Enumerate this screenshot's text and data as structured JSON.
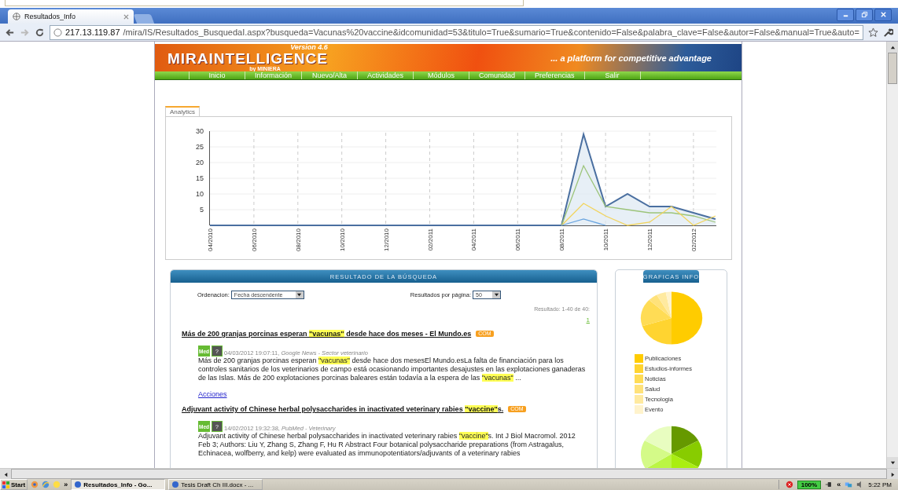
{
  "browser": {
    "tab_title": "Resultados_Info",
    "url_host": "217.13.119.87",
    "url_path": "/mira/IS/Resultados_BusquedaI.aspx?busqueda=Vacunas%20vaccine&idcomunidad=53&titulo=True&sumario=True&contenido=False&palabra_clave=False&autor=False&manual=True&auto="
  },
  "banner": {
    "logo": "MIRAINTELLIGENCE",
    "version": "Version 4.6",
    "by": "by MINIERA",
    "slogan": "... a platform for competitive advantage"
  },
  "nav": [
    "Inicio",
    "Información",
    "Nuevo/Alta",
    "Actividades",
    "Módulos",
    "Comunidad",
    "Preferencias",
    "Salir"
  ],
  "analytics": {
    "tab": "Analytics",
    "chart_data": {
      "type": "line",
      "categories": [
        "04/2010",
        null,
        "06/2010",
        null,
        "08/2010",
        null,
        "10/2010",
        null,
        "12/2010",
        null,
        "02/2011",
        null,
        "04/2011",
        null,
        "06/2011",
        null,
        "08/2011",
        null,
        "10/2011",
        null,
        "12/2011",
        null,
        "02/2012",
        null
      ],
      "ylim": [
        0,
        30
      ],
      "yticks": [
        5,
        10,
        15,
        20,
        25,
        30
      ],
      "grid": true,
      "series": [
        {
          "color": "#4a6fa0",
          "values": [
            0,
            0,
            0,
            0,
            0,
            0,
            0,
            0,
            0,
            0,
            0,
            0,
            0,
            0,
            0,
            0,
            0,
            29,
            6,
            10,
            6,
            6,
            4,
            2
          ]
        },
        {
          "color": "#9cc47a",
          "values": [
            null,
            null,
            null,
            null,
            null,
            null,
            null,
            null,
            null,
            null,
            null,
            null,
            null,
            null,
            null,
            null,
            0,
            19,
            6,
            5,
            4,
            4,
            3,
            1
          ]
        },
        {
          "color": "#f2d45c",
          "values": [
            null,
            null,
            null,
            null,
            null,
            null,
            null,
            null,
            null,
            null,
            null,
            null,
            null,
            null,
            null,
            null,
            0,
            7,
            3,
            0,
            1,
            6,
            0,
            3
          ]
        },
        {
          "color": "#6aa5e0",
          "values": [
            null,
            null,
            null,
            null,
            null,
            null,
            null,
            null,
            null,
            null,
            null,
            null,
            null,
            null,
            null,
            null,
            0,
            2,
            0,
            null,
            null,
            null,
            null,
            null
          ]
        }
      ]
    }
  },
  "results": {
    "title": "RESULTADO DE LA BÚSQUEDA",
    "order_label": "Ordenacion:",
    "order_value": "Fecha descendente",
    "per_page_label": "Resultados por página:",
    "per_page_value": "50",
    "count": "Resultado: 1-40 de 40:",
    "page_link": "1",
    "items": [
      {
        "title": [
          {
            "text": "Más de 200 granjas porcinas esperan ",
            "highlight": false
          },
          {
            "text": "\"vacunas\"",
            "highlight": true
          },
          {
            "text": " desde hace dos meses - El Mundo.es",
            "highlight": false
          }
        ],
        "tag": "COM",
        "badge_med": "Med",
        "badge_q": "?",
        "date": "04/03/2012 19:07:11, ",
        "source": "Google News - Sector veterinario",
        "body": [
          {
            "text": "Más de 200 granjas porcinas esperan ",
            "highlight": false
          },
          {
            "text": "\"vacunas\"",
            "highlight": true
          },
          {
            "text": " desde hace dos mesesEl Mundo.esLa falta de financiación para los controles sanitarios de los veterinarios de campo está ocasionando importantes desajustes en las explotaciones ganaderas de las Islas. Más de 200 explotaciones porcinas baleares están todavía a la espera de las ",
            "highlight": false
          },
          {
            "text": "\"vacunas\"",
            "highlight": true
          },
          {
            "text": " ...",
            "highlight": false
          }
        ],
        "action": "Acciones"
      },
      {
        "title": [
          {
            "text": "Adjuvant activity of Chinese herbal polysaccharides in inactivated veterinary rabies ",
            "highlight": false
          },
          {
            "text": "\"vaccine\"",
            "highlight": true
          },
          {
            "text": "s.",
            "highlight": false
          }
        ],
        "tag": "COM",
        "badge_med": "Med",
        "badge_q": "?",
        "date": "14/02/2012 19:32:38, ",
        "source": "PubMed - Veterinary",
        "body": [
          {
            "text": "Adjuvant activity of Chinese herbal polysaccharides in inactivated veterinary rabies ",
            "highlight": false
          },
          {
            "text": "\"vaccine\"",
            "highlight": true
          },
          {
            "text": "s. Int J Biol Macromol. 2012 Feb 3; Authors: Liu Y, Zhang S, Zhang F, Hu R Abstract Four botanical polysaccharide preparations (from Astragalus, Echinacea, wolfberry, and kelp) were evaluated as immunopotentiators/adjuvants of a veterinary rabies",
            "highlight": false
          }
        ]
      }
    ]
  },
  "graficas": {
    "title": "GRAFICAS INFO",
    "legend": [
      {
        "label": "Publicaciones",
        "color": "#ffcc00"
      },
      {
        "label": "Estudios-informes",
        "color": "#ffd430"
      },
      {
        "label": "Noticias",
        "color": "#ffdc55"
      },
      {
        "label": "Salud",
        "color": "#ffe27a"
      },
      {
        "label": "Tecnologia",
        "color": "#ffeaa0"
      },
      {
        "label": "Evento",
        "color": "#fff3cc"
      }
    ]
  },
  "taskbar": {
    "start": "Start",
    "more": "»",
    "tasks": [
      {
        "label": "Resultados_Info - Go...",
        "selected": true
      },
      {
        "label": "Tesis Draft Ch III.docx - ...",
        "selected": false
      }
    ],
    "zoom": "100%",
    "tray_more": "«",
    "time": "5:22 PM"
  }
}
